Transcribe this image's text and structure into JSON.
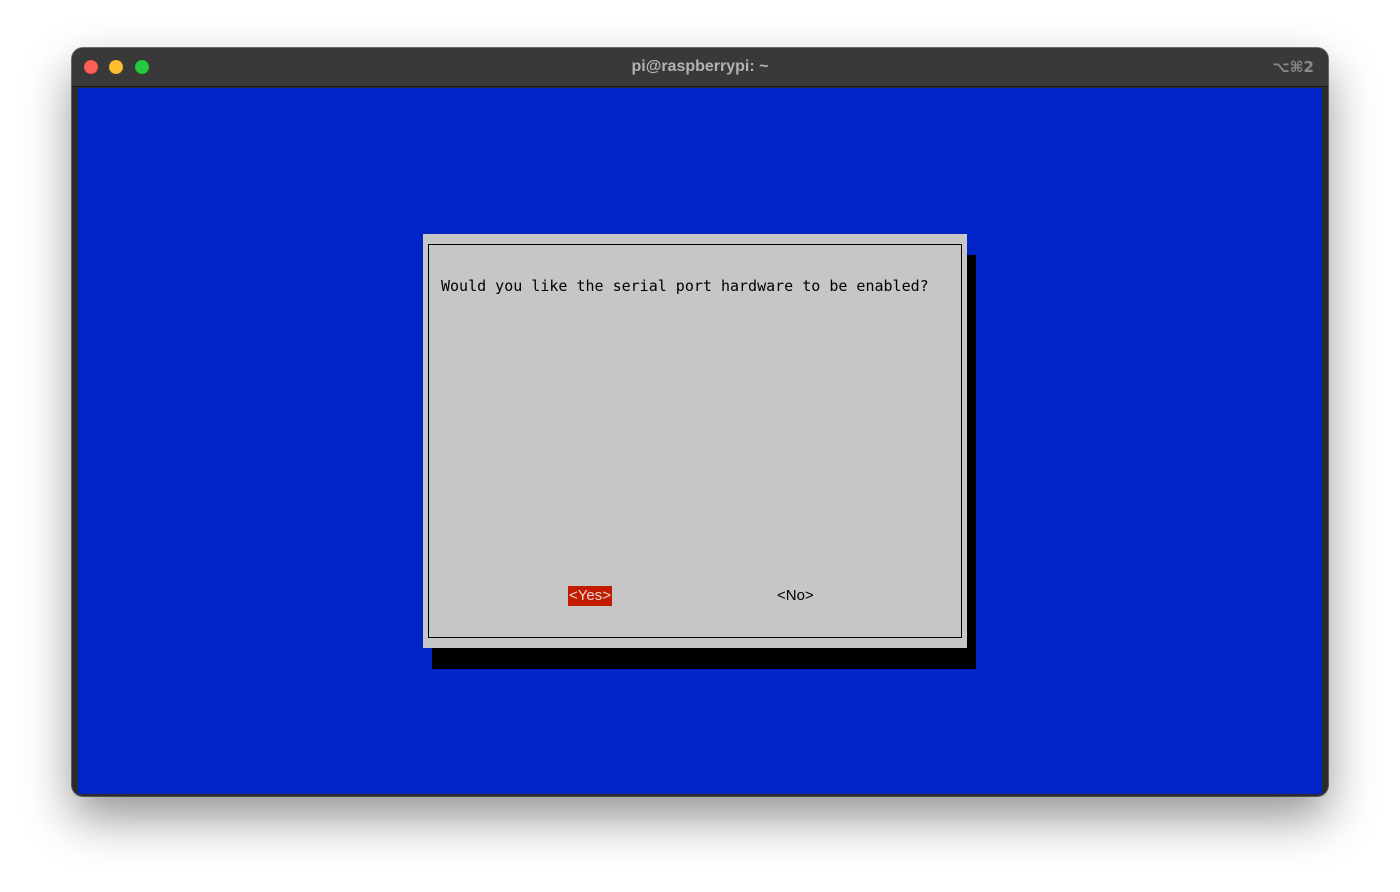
{
  "window": {
    "title": "pi@raspberrypi: ~",
    "shortcut": "⌥⌘2"
  },
  "dialog": {
    "prompt": "Would you like the serial port hardware to be enabled?",
    "buttons": {
      "yes_label": "<Yes>",
      "no_label": "<No>",
      "selected": "yes"
    }
  },
  "colors": {
    "terminal_background": "#0024c8",
    "dialog_background": "#c6c6c6",
    "selected_button": "#c21b00"
  }
}
